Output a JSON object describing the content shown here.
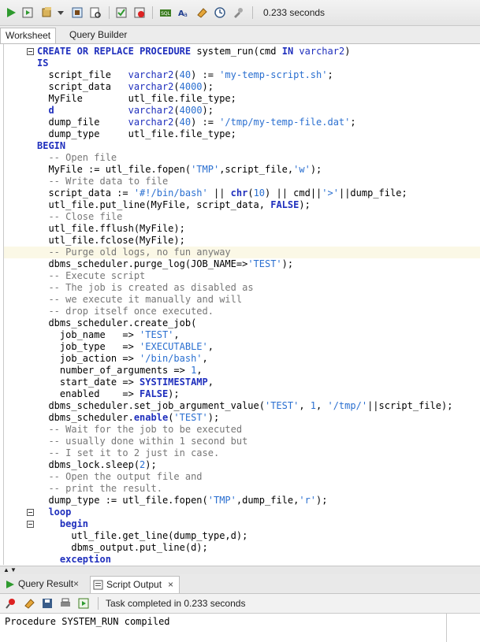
{
  "toolbar": {
    "elapsed": "0.233 seconds"
  },
  "editor_tabs": [
    {
      "label": "Worksheet",
      "active": true
    },
    {
      "label": "Query Builder",
      "active": false
    }
  ],
  "code_lines": [
    {
      "text": "CREATE OR REPLACE PROCEDURE system_run(cmd IN varchar2)",
      "fold": true
    },
    {
      "text": "IS",
      "fold": false
    },
    {
      "text": "  script_file   varchar2(40) := 'my-temp-script.sh';",
      "fold": false
    },
    {
      "text": "  script_data   varchar2(4000);",
      "fold": false
    },
    {
      "text": "  MyFile        utl_file.file_type;",
      "fold": false
    },
    {
      "text": "  d             varchar2(4000);",
      "fold": false
    },
    {
      "text": "  dump_file     varchar2(40) := '/tmp/my-temp-file.dat';",
      "fold": false
    },
    {
      "text": "  dump_type     utl_file.file_type;",
      "fold": false
    },
    {
      "text": "BEGIN",
      "fold": false
    },
    {
      "text": "  -- Open file",
      "fold": false
    },
    {
      "text": "  MyFile := utl_file.fopen('TMP',script_file,'w');",
      "fold": false
    },
    {
      "text": "  -- Write data to file",
      "fold": false
    },
    {
      "text": "  script_data := '#!/bin/bash' || chr(10) || cmd||'>'||dump_file;",
      "fold": false
    },
    {
      "text": "  utl_file.put_line(MyFile, script_data, FALSE);",
      "fold": false
    },
    {
      "text": "  -- Close file",
      "fold": false
    },
    {
      "text": "  utl_file.fflush(MyFile);",
      "fold": false
    },
    {
      "text": "  utl_file.fclose(MyFile);",
      "fold": false
    },
    {
      "text": "  -- Purge old logs, no fun anyway",
      "fold": false,
      "highlight": true
    },
    {
      "text": "  dbms_scheduler.purge_log(JOB_NAME=>'TEST');",
      "fold": false
    },
    {
      "text": "  -- Execute script",
      "fold": false
    },
    {
      "text": "  -- The job is created as disabled as",
      "fold": false
    },
    {
      "text": "  -- we execute it manually and will",
      "fold": false
    },
    {
      "text": "  -- drop itself once executed.",
      "fold": false
    },
    {
      "text": "  dbms_scheduler.create_job(",
      "fold": false
    },
    {
      "text": "    job_name   => 'TEST',",
      "fold": false
    },
    {
      "text": "    job_type   => 'EXECUTABLE',",
      "fold": false
    },
    {
      "text": "    job_action => '/bin/bash',",
      "fold": false
    },
    {
      "text": "    number_of_arguments => 1,",
      "fold": false
    },
    {
      "text": "    start_date => SYSTIMESTAMP,",
      "fold": false
    },
    {
      "text": "    enabled    => FALSE);",
      "fold": false
    },
    {
      "text": "  dbms_scheduler.set_job_argument_value('TEST', 1, '/tmp/'||script_file);",
      "fold": false
    },
    {
      "text": "  dbms_scheduler.enable('TEST');",
      "fold": false
    },
    {
      "text": "  -- Wait for the job to be executed",
      "fold": false
    },
    {
      "text": "  -- usually done within 1 second but",
      "fold": false
    },
    {
      "text": "  -- I set it to 2 just in case.",
      "fold": false
    },
    {
      "text": "  dbms_lock.sleep(2);",
      "fold": false
    },
    {
      "text": "  -- Open the output file and",
      "fold": false
    },
    {
      "text": "  -- print the result.",
      "fold": false
    },
    {
      "text": "  dump_type := utl_file.fopen('TMP',dump_file,'r');",
      "fold": false
    },
    {
      "text": "  loop",
      "fold": true
    },
    {
      "text": "    begin",
      "fold": true
    },
    {
      "text": "      utl_file.get_line(dump_type,d);",
      "fold": false
    },
    {
      "text": "      dbms_output.put_line(d);",
      "fold": false
    },
    {
      "text": "    exception",
      "fold": false
    }
  ],
  "output_tabs": [
    {
      "label": "Query Result",
      "active": false
    },
    {
      "label": "Script Output",
      "active": true
    }
  ],
  "output_toolbar": {
    "status": "Task completed in 0.233 seconds"
  },
  "output": {
    "text": "Procedure SYSTEM_RUN compiled"
  },
  "colors": {
    "keyword": "#1f2fbd",
    "string": "#2a6fd0",
    "comment": "#777777",
    "highlight_line": "#fbf8e6"
  }
}
